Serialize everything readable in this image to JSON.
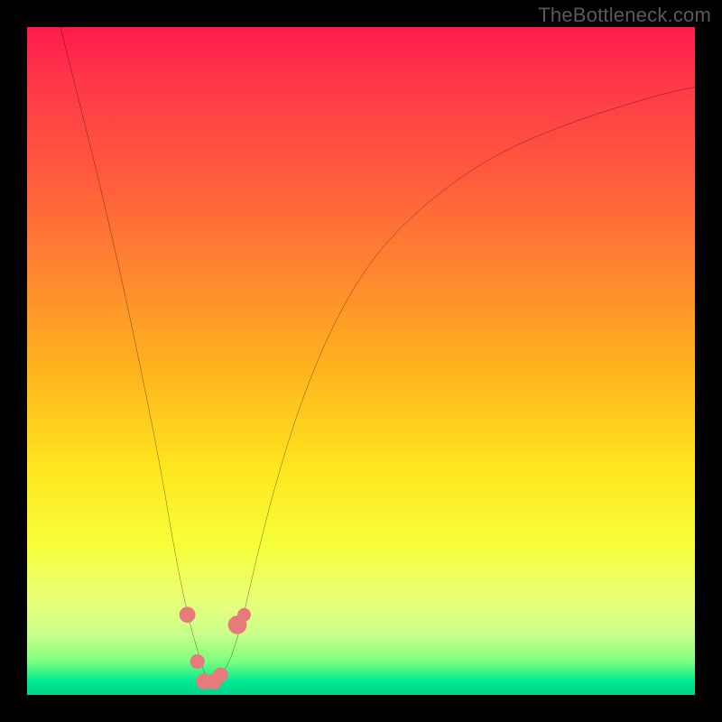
{
  "watermark": "TheBottleneck.com",
  "chart_data": {
    "type": "line",
    "title": "",
    "xlabel": "",
    "ylabel": "",
    "xlim": [
      0,
      100
    ],
    "ylim": [
      0,
      100
    ],
    "grid": false,
    "series": [
      {
        "name": "bottleneck-curve",
        "color": "#000000",
        "x": [
          5,
          8,
          11,
          14,
          17,
          20,
          22,
          24,
          26,
          27,
          28,
          30,
          32,
          34,
          37,
          41,
          46,
          52,
          60,
          70,
          82,
          95,
          100
        ],
        "y": [
          100,
          88,
          76,
          63,
          49,
          34,
          22,
          12,
          5,
          2,
          2,
          4,
          10,
          19,
          31,
          44,
          56,
          66,
          74,
          81,
          86,
          90,
          91
        ]
      }
    ],
    "markers": [
      {
        "x": 24.0,
        "y": 12.0,
        "r": 1.2,
        "color": "#e77a7a"
      },
      {
        "x": 25.5,
        "y": 5.0,
        "r": 1.1,
        "color": "#e77a7a"
      },
      {
        "x": 26.5,
        "y": 2.0,
        "r": 1.2,
        "color": "#e77a7a"
      },
      {
        "x": 28.0,
        "y": 2.0,
        "r": 1.2,
        "color": "#e77a7a"
      },
      {
        "x": 29.0,
        "y": 3.0,
        "r": 1.1,
        "color": "#e77a7a"
      },
      {
        "x": 31.5,
        "y": 10.5,
        "r": 1.4,
        "color": "#e77a7a"
      },
      {
        "x": 32.5,
        "y": 12.0,
        "r": 1.0,
        "color": "#e77a7a"
      }
    ]
  }
}
